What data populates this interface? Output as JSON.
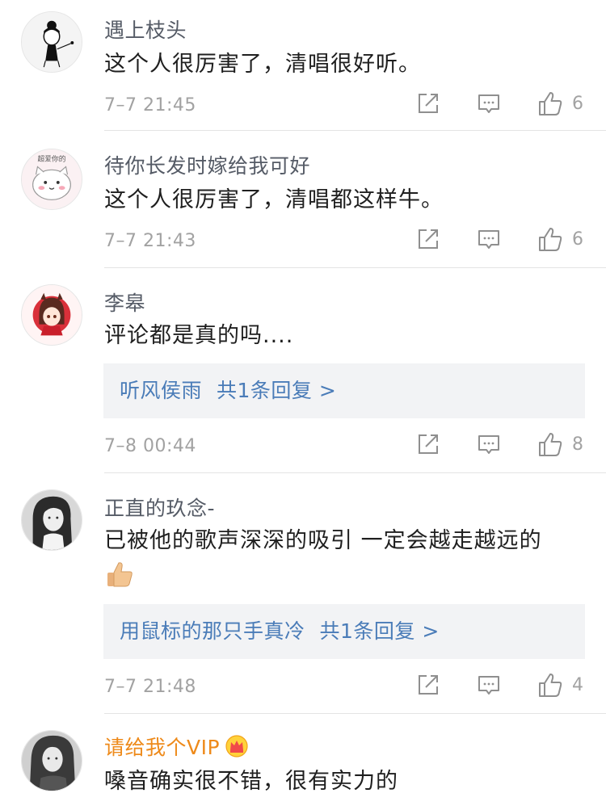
{
  "comments": [
    {
      "username": "遇上枝头",
      "content": "这个人很厉害了，清唱很好听。",
      "timestamp": "7–7 21:45",
      "likes": "6",
      "avatar_icon": "girl-hair-bun-sketch"
    },
    {
      "username": "待你长发时嫁给我可好",
      "content": "这个人很厉害了，清唱都这样牛。",
      "timestamp": "7–7 21:43",
      "likes": "6",
      "avatar_icon": "cartoon-cat-pink",
      "avatar_text": "超爱你的"
    },
    {
      "username": "李皋",
      "content": "评论都是真的吗....",
      "reply_user": "听风侯雨",
      "reply_count": "共1条回复 >",
      "timestamp": "7–8 00:44",
      "likes": "8",
      "avatar_icon": "anime-girl-red"
    },
    {
      "username": "正直的玖念-",
      "content": "已被他的歌声深深的吸引 一定会越走越远的",
      "emoji": "thumbs-up-emoji",
      "reply_user": "用鼠标的那只手真冷",
      "reply_count": "共1条回复 >",
      "timestamp": "7–7 21:48",
      "likes": "4",
      "avatar_icon": "portrait-photo-bw"
    },
    {
      "username": "请给我个VIP",
      "vip_badge": "crown-icon",
      "content": "嗓音确实很不错，很有实力的",
      "avatar_icon": "portrait-photo-bw-2"
    }
  ],
  "colors": {
    "username": "#555b66",
    "vip_username": "#ee8a1a",
    "reply_link": "#4a7cb8",
    "meta": "#a2a2a2",
    "reply_bg": "#f2f3f5"
  }
}
